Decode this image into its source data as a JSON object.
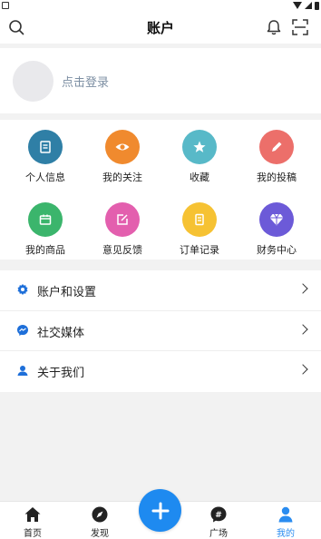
{
  "header": {
    "title": "账户",
    "left_icon": "search-icon",
    "right_icons": [
      "bell-icon",
      "scan-icon"
    ]
  },
  "login": {
    "prompt": "点击登录"
  },
  "grid": {
    "items": [
      {
        "label": "个人信息",
        "icon": "id-card-icon",
        "color": "#2f7fa6"
      },
      {
        "label": "我的关注",
        "icon": "eye-icon",
        "color": "#f08a2e"
      },
      {
        "label": "收藏",
        "icon": "star-icon",
        "color": "#58b9c8"
      },
      {
        "label": "我的投稿",
        "icon": "pencil-icon",
        "color": "#ec6f6a"
      },
      {
        "label": "我的商品",
        "icon": "box-icon",
        "color": "#3bb56c"
      },
      {
        "label": "意见反馈",
        "icon": "edit-icon",
        "color": "#e35fae"
      },
      {
        "label": "订单记录",
        "icon": "receipt-icon",
        "color": "#f6c233"
      },
      {
        "label": "财务中心",
        "icon": "diamond-icon",
        "color": "#6c5ad8"
      }
    ]
  },
  "menu": {
    "items": [
      {
        "label": "账户和设置",
        "icon": "gear-icon"
      },
      {
        "label": "社交媒体",
        "icon": "messenger-icon"
      },
      {
        "label": "关于我们",
        "icon": "user-support-icon"
      }
    ]
  },
  "tabbar": {
    "items": [
      {
        "label": "首页",
        "icon": "home-icon",
        "active": false
      },
      {
        "label": "发现",
        "icon": "compass-icon",
        "active": false
      },
      {
        "label": "广场",
        "icon": "hashtag-icon",
        "active": false
      },
      {
        "label": "我的",
        "icon": "person-icon",
        "active": true
      }
    ],
    "fab_icon": "plus-icon"
  },
  "colors": {
    "accent": "#1e8af0",
    "active_tab": "#2a8cf0",
    "menu_icon": "#1e6fd9"
  }
}
